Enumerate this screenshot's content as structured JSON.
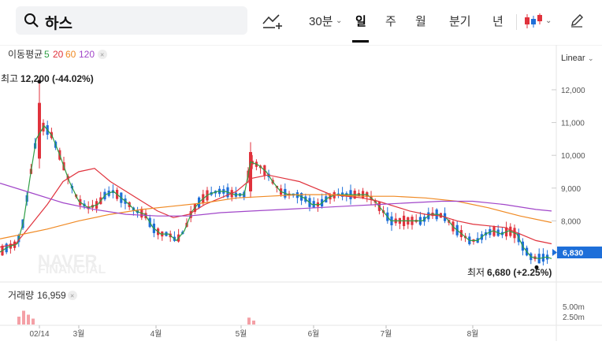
{
  "header": {
    "search_value": "하스",
    "interval_label": "30분",
    "periods": [
      "일",
      "주",
      "월",
      "분기",
      "년"
    ],
    "active_period": "일",
    "scale_label": "Linear"
  },
  "ma_legend": {
    "title": "이동평균",
    "items": [
      {
        "label": "5",
        "color": "#2e9e44"
      },
      {
        "label": "20",
        "color": "#e0323c"
      },
      {
        "label": "60",
        "color": "#f08a24"
      },
      {
        "label": "120",
        "color": "#a146c9"
      }
    ]
  },
  "annotations": {
    "high_label": "최고",
    "high_value": "12,200 (-44.02%)",
    "low_label": "최저",
    "low_value": "6,680 (+2.25%)",
    "watermark_1": "NAVER",
    "watermark_2": "FINANCIAL"
  },
  "volume": {
    "label": "거래량",
    "value": "16,959",
    "axis_ticks": [
      "5.00m",
      "2.50m"
    ]
  },
  "current_price": "6,830",
  "colors": {
    "up": "#e0323c",
    "down": "#1e6fd9",
    "ma5": "#2e9e44",
    "ma20": "#e0323c",
    "ma60": "#f08a24",
    "ma120": "#a146c9",
    "price_tag": "#1e6fd9"
  },
  "chart_data": {
    "type": "line",
    "y_ticks": [
      12000,
      11000,
      10000,
      9000,
      8000,
      7000
    ],
    "x_labels": [
      "02/14",
      "3월",
      "4월",
      "5월",
      "6월",
      "7월",
      "8월"
    ],
    "ylim": [
      6400,
      12600
    ],
    "series": [
      {
        "name": "5",
        "points": [
          [
            0,
            7050
          ],
          [
            10,
            7200
          ],
          [
            22,
            7300
          ],
          [
            30,
            8000
          ],
          [
            38,
            9300
          ],
          [
            46,
            10500
          ],
          [
            56,
            10900
          ],
          [
            66,
            10600
          ],
          [
            76,
            10000
          ],
          [
            88,
            9200
          ],
          [
            100,
            8600
          ],
          [
            112,
            8400
          ],
          [
            124,
            8500
          ],
          [
            134,
            8800
          ],
          [
            144,
            8900
          ],
          [
            154,
            8700
          ],
          [
            164,
            8500
          ],
          [
            172,
            8300
          ],
          [
            184,
            8200
          ],
          [
            194,
            7800
          ],
          [
            204,
            7600
          ],
          [
            214,
            7600
          ],
          [
            224,
            7400
          ],
          [
            234,
            7700
          ],
          [
            244,
            8300
          ],
          [
            254,
            8600
          ],
          [
            264,
            8800
          ],
          [
            276,
            8900
          ],
          [
            286,
            8900
          ],
          [
            298,
            8800
          ],
          [
            310,
            8800
          ],
          [
            318,
            9800
          ],
          [
            328,
            9700
          ],
          [
            338,
            9500
          ],
          [
            346,
            9200
          ],
          [
            356,
            8900
          ],
          [
            366,
            8800
          ],
          [
            376,
            8800
          ],
          [
            386,
            8700
          ],
          [
            396,
            8500
          ],
          [
            406,
            8500
          ],
          [
            416,
            8700
          ],
          [
            426,
            8800
          ],
          [
            436,
            8800
          ],
          [
            446,
            8800
          ],
          [
            456,
            8800
          ],
          [
            466,
            8800
          ],
          [
            476,
            8600
          ],
          [
            486,
            8300
          ],
          [
            496,
            8000
          ],
          [
            506,
            8000
          ],
          [
            516,
            8000
          ],
          [
            526,
            8000
          ],
          [
            536,
            8000
          ],
          [
            546,
            8200
          ],
          [
            556,
            8200
          ],
          [
            566,
            8100
          ],
          [
            576,
            7800
          ],
          [
            586,
            7600
          ],
          [
            596,
            7400
          ],
          [
            606,
            7400
          ],
          [
            616,
            7600
          ],
          [
            626,
            7700
          ],
          [
            636,
            7600
          ],
          [
            646,
            7700
          ],
          [
            656,
            7600
          ],
          [
            664,
            7200
          ],
          [
            674,
            6900
          ],
          [
            684,
            6850
          ],
          [
            694,
            6900
          ],
          [
            700,
            6850
          ]
        ]
      },
      {
        "name": "20",
        "points": [
          [
            0,
            7200
          ],
          [
            20,
            7300
          ],
          [
            40,
            7900
          ],
          [
            60,
            8500
          ],
          [
            80,
            9200
          ],
          [
            100,
            9500
          ],
          [
            120,
            9600
          ],
          [
            140,
            9200
          ],
          [
            160,
            8900
          ],
          [
            180,
            8600
          ],
          [
            200,
            8300
          ],
          [
            220,
            8100
          ],
          [
            240,
            8200
          ],
          [
            260,
            8500
          ],
          [
            280,
            8700
          ],
          [
            300,
            8900
          ],
          [
            320,
            9300
          ],
          [
            340,
            9400
          ],
          [
            360,
            9300
          ],
          [
            380,
            9200
          ],
          [
            400,
            9000
          ],
          [
            420,
            8800
          ],
          [
            440,
            8750
          ],
          [
            460,
            8700
          ],
          [
            480,
            8600
          ],
          [
            500,
            8450
          ],
          [
            520,
            8300
          ],
          [
            540,
            8200
          ],
          [
            560,
            8150
          ],
          [
            580,
            8000
          ],
          [
            600,
            7900
          ],
          [
            620,
            7850
          ],
          [
            640,
            7800
          ],
          [
            660,
            7600
          ],
          [
            680,
            7400
          ],
          [
            700,
            7300
          ]
        ]
      },
      {
        "name": "60",
        "points": [
          [
            0,
            7450
          ],
          [
            30,
            7600
          ],
          [
            60,
            7750
          ],
          [
            100,
            8000
          ],
          [
            140,
            8200
          ],
          [
            180,
            8350
          ],
          [
            220,
            8450
          ],
          [
            260,
            8550
          ],
          [
            300,
            8700
          ],
          [
            340,
            8750
          ],
          [
            380,
            8800
          ],
          [
            420,
            8800
          ],
          [
            460,
            8750
          ],
          [
            500,
            8750
          ],
          [
            540,
            8700
          ],
          [
            580,
            8600
          ],
          [
            620,
            8400
          ],
          [
            660,
            8150
          ],
          [
            700,
            7950
          ]
        ]
      },
      {
        "name": "120",
        "points": [
          [
            0,
            9150
          ],
          [
            40,
            8850
          ],
          [
            80,
            8550
          ],
          [
            120,
            8350
          ],
          [
            160,
            8200
          ],
          [
            200,
            8150
          ],
          [
            240,
            8150
          ],
          [
            280,
            8250
          ],
          [
            320,
            8300
          ],
          [
            360,
            8350
          ],
          [
            400,
            8400
          ],
          [
            440,
            8450
          ],
          [
            480,
            8500
          ],
          [
            520,
            8550
          ],
          [
            560,
            8600
          ],
          [
            600,
            8600
          ],
          [
            640,
            8500
          ],
          [
            680,
            8350
          ],
          [
            700,
            8300
          ]
        ]
      }
    ],
    "volume_bars": [
      [
        24,
        0.4
      ],
      [
        30,
        0.7
      ],
      [
        36,
        0.5
      ],
      [
        42,
        0.3
      ],
      [
        316,
        0.35
      ],
      [
        322,
        0.2
      ]
    ]
  }
}
